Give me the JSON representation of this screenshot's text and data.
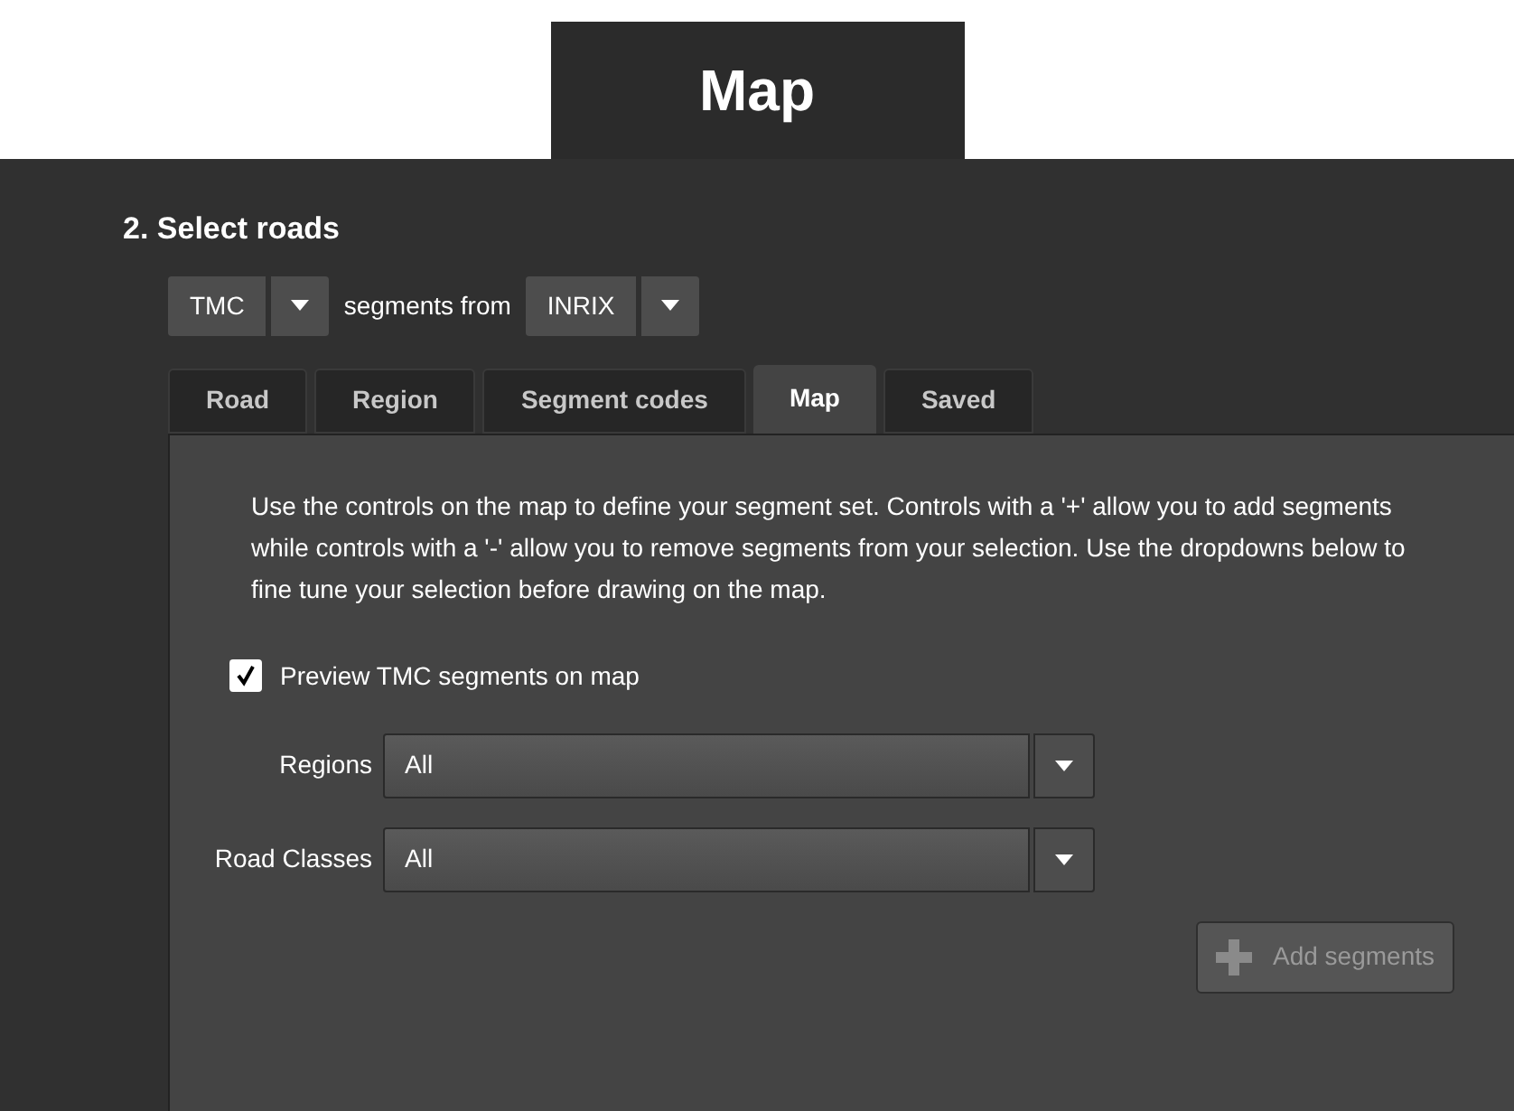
{
  "header": {
    "title": "Map"
  },
  "section": {
    "title": "2. Select roads"
  },
  "source": {
    "type_select": {
      "value": "TMC"
    },
    "connector": "segments from",
    "provider_select": {
      "value": "INRIX"
    }
  },
  "tabs": [
    {
      "label": "Road",
      "selected": false
    },
    {
      "label": "Region",
      "selected": false
    },
    {
      "label": "Segment codes",
      "selected": false
    },
    {
      "label": "Map",
      "selected": true
    },
    {
      "label": "Saved",
      "selected": false
    }
  ],
  "panel": {
    "description": "Use the controls on the map to define your segment set. Controls with a '+' allow you to add segments while controls with a '-' allow you to remove segments from your selection. Use the dropdowns below to fine tune your selection before drawing on the map.",
    "preview_checkbox": {
      "label": "Preview TMC segments on map",
      "checked": true
    },
    "filters": [
      {
        "label": "Regions",
        "value": "All"
      },
      {
        "label": "Road Classes",
        "value": "All"
      }
    ],
    "add_button": {
      "label": "Add segments",
      "disabled": true
    }
  }
}
